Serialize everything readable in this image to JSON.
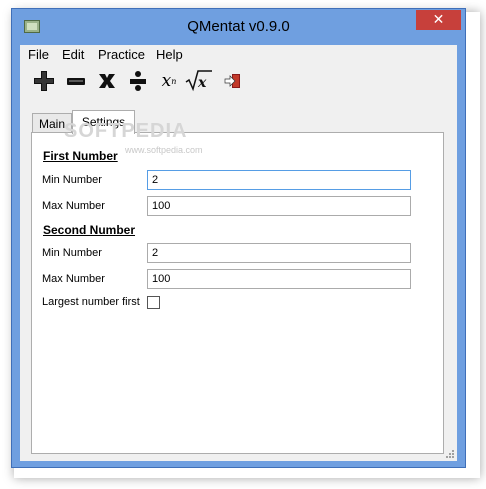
{
  "window": {
    "title": "QMentat v0.9.0",
    "close_symbol": "✕"
  },
  "menu": {
    "items": [
      "File",
      "Edit",
      "Practice",
      "Help"
    ]
  },
  "toolbar": {
    "icons": [
      "plus-icon",
      "minus-icon",
      "multiply-icon",
      "divide-icon",
      "power-icon",
      "square-root-icon",
      "exit-icon"
    ],
    "power_label": "x",
    "power_exp": "n",
    "sqrt_label": "x"
  },
  "tabs": [
    {
      "label": "Main",
      "active": false
    },
    {
      "label": "Settings",
      "active": true
    }
  ],
  "settings": {
    "first_number": {
      "heading": "First Number",
      "min_label": "Min Number",
      "min_value": "2",
      "max_label": "Max Number",
      "max_value": "100"
    },
    "second_number": {
      "heading": "Second Number",
      "min_label": "Min Number",
      "min_value": "2",
      "max_label": "Max Number",
      "max_value": "100"
    },
    "largest_first": {
      "label": "Largest number first",
      "checked": false
    }
  },
  "watermark": {
    "text": "SOFTPEDIA",
    "url": "www.softpedia.com"
  },
  "colors": {
    "frame": "#6f9fe0",
    "close": "#c7403b",
    "focus_border": "#569de5"
  }
}
